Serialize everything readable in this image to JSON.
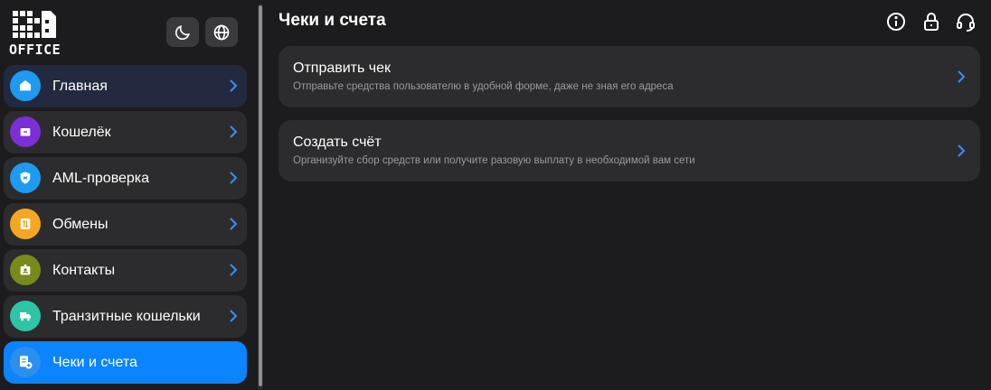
{
  "brand": {
    "logo_text": "OFFICE"
  },
  "sidebar": {
    "items": [
      {
        "label": "Главная",
        "icon": "home-icon",
        "color": "#1e9bf0"
      },
      {
        "label": "Кошелёк",
        "icon": "wallet-icon",
        "color": "#7b2fd6"
      },
      {
        "label": "AML-проверка",
        "icon": "shield-icon",
        "color": "#1e9bf0"
      },
      {
        "label": "Обмены",
        "icon": "exchange-icon",
        "color": "#f5a623"
      },
      {
        "label": "Контакты",
        "icon": "contacts-icon",
        "color": "#7a8a1a"
      },
      {
        "label": "Транзитные кошельки",
        "icon": "truck-icon",
        "color": "#2ec4a6"
      },
      {
        "label": "Чеки и счета",
        "icon": "invoice-icon",
        "color": "#2b8ff0"
      }
    ],
    "active_index": 6
  },
  "main": {
    "title": "Чеки и счета",
    "cards": [
      {
        "title": "Отправить чек",
        "subtitle": "Отправьте средства пользователю в удобной форме, даже не зная его адреса"
      },
      {
        "title": "Создать счёт",
        "subtitle": "Организуйте сбор средств или получите разовую выплату в необходимой вам сети"
      }
    ]
  },
  "colors": {
    "accent": "#0a84ff",
    "background": "#1c1c1e",
    "card": "#2c2c2e",
    "chevron": "#3a8ff5"
  }
}
